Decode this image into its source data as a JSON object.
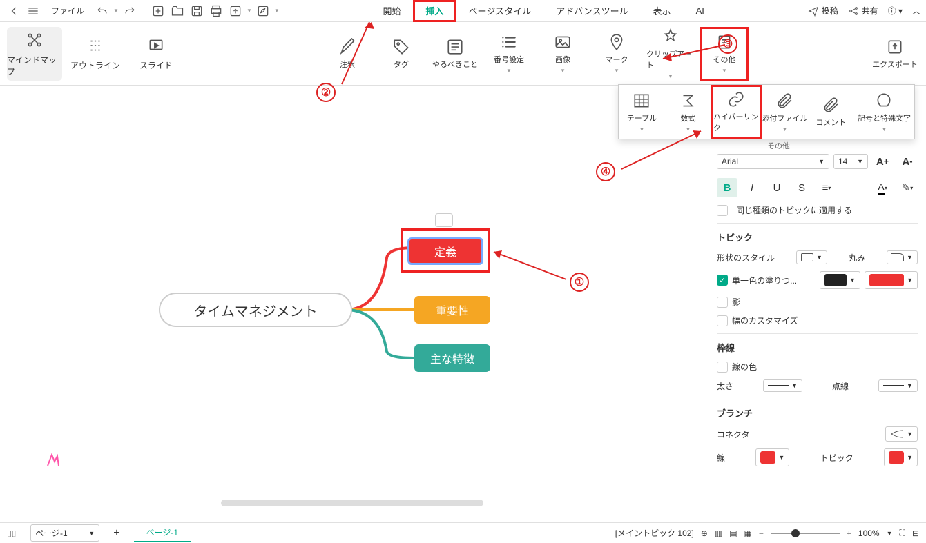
{
  "topbar": {
    "file_label": "ファイル",
    "menu": [
      "開始",
      "挿入",
      "ページスタイル",
      "アドバンスツール",
      "表示",
      "AI"
    ],
    "active_menu": 1,
    "post": "投稿",
    "share": "共有"
  },
  "ribbon": {
    "views": [
      {
        "label": "マインドマップ"
      },
      {
        "label": "アウトライン"
      },
      {
        "label": "スライド"
      }
    ],
    "insert": [
      {
        "label": "注釈"
      },
      {
        "label": "タグ"
      },
      {
        "label": "やるべきこと"
      },
      {
        "label": "番号設定",
        "drop": true
      },
      {
        "label": "画像",
        "drop": true
      },
      {
        "label": "マーク",
        "drop": true
      },
      {
        "label": "クリップアート",
        "drop": true
      },
      {
        "label": "その他",
        "drop": true
      },
      {
        "label": "エクスポート"
      }
    ]
  },
  "submenu": {
    "items": [
      {
        "label": "テーブル",
        "drop": true
      },
      {
        "label": "数式",
        "drop": true
      },
      {
        "label": "ハイパーリンク"
      },
      {
        "label": "添付ファイル",
        "drop": true
      },
      {
        "label": "コメント"
      },
      {
        "label": "記号と特殊文字",
        "drop": true
      }
    ],
    "footer": "その他"
  },
  "mindmap": {
    "central": "タイムマネジメント",
    "nodes": [
      "定義",
      "重要性",
      "主な特徴"
    ],
    "branch_colors": [
      "#e33",
      "#f5a623",
      "#3a9"
    ]
  },
  "annotations": {
    "c1": "①",
    "c2": "②",
    "c3": "③",
    "c4": "④"
  },
  "sidepanel": {
    "font": "Arial",
    "size": "14",
    "same_type": "同じ種類のトピックに適用する",
    "topic": "トピック",
    "shape_style": "形状のスタイル",
    "round": "丸み",
    "solid_fill": "単一色の塗りつ...",
    "shadow": "影",
    "custom_width": "幅のカスタマイズ",
    "border": "枠線",
    "border_color": "線の色",
    "thickness": "太さ",
    "dash": "点線",
    "branch": "ブランチ",
    "connector": "コネクタ",
    "line": "線",
    "topic2": "トピック",
    "fill_color": "#e33",
    "line_color": "#e33",
    "border_swatch": "#222"
  },
  "status": {
    "page_sel": "ページ-1",
    "tab": "ページ-1",
    "topic_info": "[メイントピック 102]",
    "zoom": "100%"
  }
}
